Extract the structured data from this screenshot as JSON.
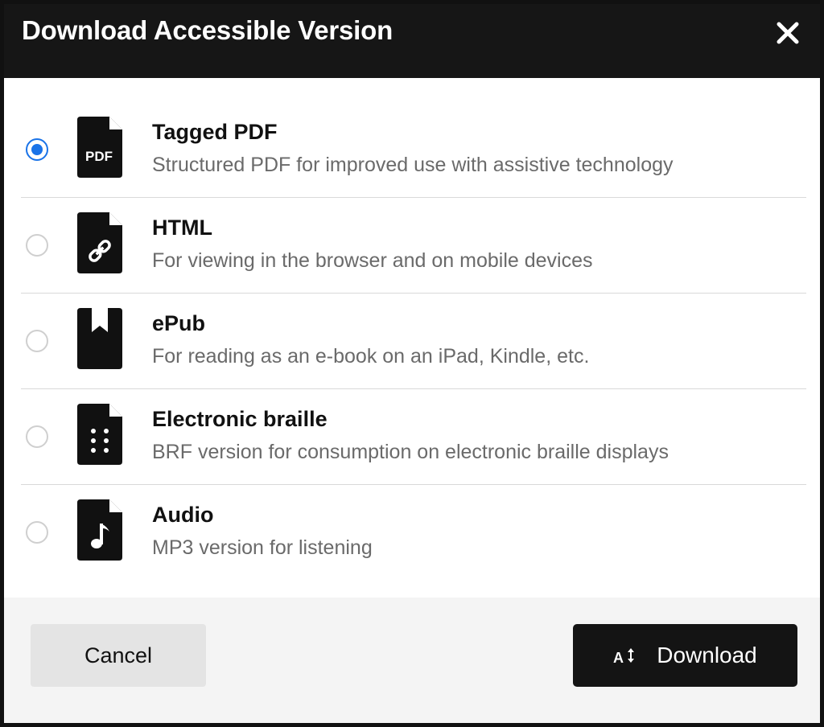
{
  "dialog": {
    "title": "Download Accessible Version",
    "close_icon": "close-icon"
  },
  "options": [
    {
      "id": "tagged-pdf",
      "title": "Tagged PDF",
      "description": "Structured PDF for improved use with assistive technology",
      "icon": "pdf-file-icon",
      "icon_label": "PDF",
      "selected": true
    },
    {
      "id": "html",
      "title": "HTML",
      "description": "For viewing in the browser and on mobile devices",
      "icon": "link-file-icon",
      "selected": false
    },
    {
      "id": "epub",
      "title": "ePub",
      "description": "For reading as an e-book on an iPad, Kindle, etc.",
      "icon": "bookmark-book-icon",
      "selected": false
    },
    {
      "id": "electronic-braille",
      "title": "Electronic braille",
      "description": "BRF version for consumption on electronic braille displays",
      "icon": "braille-file-icon",
      "selected": false
    },
    {
      "id": "audio",
      "title": "Audio",
      "description": "MP3 version for listening",
      "icon": "music-file-icon",
      "selected": false
    }
  ],
  "footer": {
    "cancel_label": "Cancel",
    "download_label": "Download",
    "download_icon": "text-sort-icon"
  },
  "colors": {
    "header_bg": "#161616",
    "accent": "#1a73e8",
    "download_bg": "#141414",
    "cancel_bg": "#e4e4e4",
    "footer_bg": "#f4f4f4"
  }
}
